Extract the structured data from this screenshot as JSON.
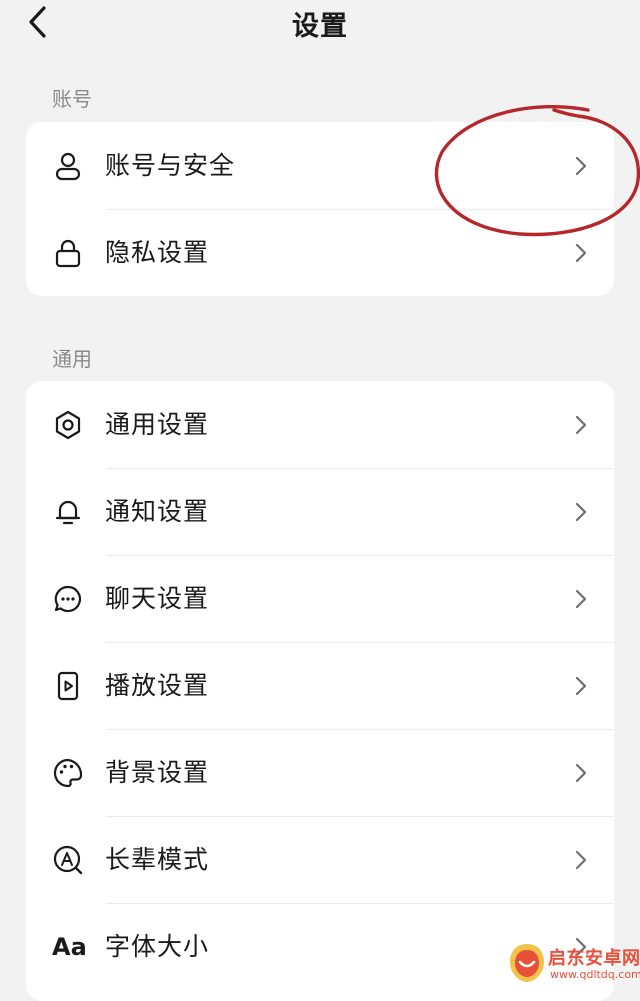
{
  "header": {
    "title": "设置",
    "back_icon": "chevron-left-icon"
  },
  "sections": [
    {
      "label": "账号",
      "items": [
        {
          "label": "账号与安全",
          "icon": "user-icon"
        },
        {
          "label": "隐私设置",
          "icon": "lock-icon"
        }
      ]
    },
    {
      "label": "通用",
      "items": [
        {
          "label": "通用设置",
          "icon": "gear-icon"
        },
        {
          "label": "通知设置",
          "icon": "bell-icon"
        },
        {
          "label": "聊天设置",
          "icon": "chat-bubble-icon"
        },
        {
          "label": "播放设置",
          "icon": "play-icon"
        },
        {
          "label": "背景设置",
          "icon": "palette-icon"
        },
        {
          "label": "长辈模式",
          "icon": "elder-mode-icon"
        },
        {
          "label": "字体大小",
          "icon": "font-size-icon",
          "icon_text": "Aa"
        }
      ]
    }
  ],
  "watermark": {
    "text": "启东安卓网",
    "url": "www.qdltdq.com"
  },
  "colors": {
    "background": "#f2f2f2",
    "card": "#ffffff",
    "annotation": "#b5272a",
    "watermark": "#e8503a"
  }
}
